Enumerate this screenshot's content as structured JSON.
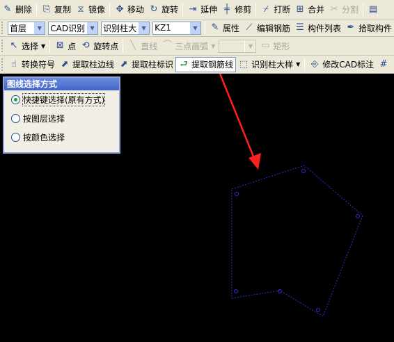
{
  "toolbar1": {
    "delete": "删除",
    "copy": "复制",
    "mirror": "镜像",
    "move": "移动",
    "rotate": "旋转",
    "extend": "延伸",
    "trim": "修剪",
    "break": "打断",
    "merge": "合并",
    "split": "分割"
  },
  "toolbar2": {
    "floor_select": "首层",
    "cad_recognize_select": "CAD识别",
    "column_recognize_select": "识别柱大",
    "column_name_select": "KZ1",
    "properties": "属性",
    "edit_rebar": "编辑钢筋",
    "component_list": "构件列表",
    "pick_component": "拾取构件"
  },
  "toolbar3": {
    "select": "选择",
    "point": "点",
    "rotate_point": "旋转点",
    "line": "直线",
    "three_point_arc": "三点画弧",
    "rect": "矩形"
  },
  "toolbar4": {
    "convert_symbol": "转换符号",
    "extract_column_edge": "提取柱边线",
    "extract_column_mark": "提取柱标识",
    "extract_rebar_line": "提取钢筋线",
    "recognize_column_detail": "识别柱大样",
    "modify_cad_mark": "修改CAD标注"
  },
  "panel": {
    "title": "图线选择方式",
    "options": [
      "快捷键选择(原有方式)",
      "按图层选择",
      "按颜色选择"
    ],
    "selected_index": 0
  },
  "colors": {
    "toolbar_bg": "#ece9d8",
    "canvas_bg": "#000000",
    "polygon_line": "#2f2fd8",
    "annotation_arrow": "#ff2020",
    "panel_title": "#4a6cd0"
  }
}
